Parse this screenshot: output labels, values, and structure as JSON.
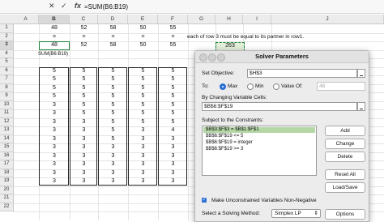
{
  "formula_bar": {
    "cancel_icon": "x-icon",
    "confirm_icon": "check-icon",
    "fx_label": "fx",
    "formula": "=SUM(B6:B19)"
  },
  "columns": [
    "A",
    "B",
    "C",
    "D",
    "E",
    "F",
    "G",
    "H",
    "I",
    "J"
  ],
  "rows": [
    "1",
    "2",
    "3",
    "4",
    "5",
    "6",
    "7",
    "8",
    "9",
    "10",
    "11",
    "12",
    "13",
    "14",
    "15",
    "16",
    "17",
    "18",
    "19",
    "20",
    "21",
    "22"
  ],
  "sheet": {
    "row1": [
      "48",
      "52",
      "58",
      "50",
      "55"
    ],
    "row2": [
      "=",
      "=",
      "=",
      "=",
      "="
    ],
    "row3": [
      "48",
      "52",
      "58",
      "50",
      "55"
    ],
    "b4_label": "SUM(B6:B19)",
    "h3_value": "263",
    "note": "each of row 3 must be equal to its partner in row1.",
    "data_rows": [
      [
        "5",
        "5",
        "5",
        "5",
        "5"
      ],
      [
        "5",
        "5",
        "5",
        "5",
        "5"
      ],
      [
        "5",
        "5",
        "5",
        "5",
        "5"
      ],
      [
        "5",
        "5",
        "5",
        "5",
        "5"
      ],
      [
        "3",
        "5",
        "5",
        "5",
        "5"
      ],
      [
        "3",
        "5",
        "5",
        "5",
        "5"
      ],
      [
        "3",
        "3",
        "5",
        "5",
        "5"
      ],
      [
        "3",
        "3",
        "5",
        "3",
        "4"
      ],
      [
        "3",
        "3",
        "5",
        "3",
        "3"
      ],
      [
        "3",
        "3",
        "3",
        "3",
        "3"
      ],
      [
        "3",
        "3",
        "3",
        "3",
        "3"
      ],
      [
        "3",
        "3",
        "3",
        "3",
        "3"
      ],
      [
        "3",
        "3",
        "3",
        "3",
        "3"
      ],
      [
        "3",
        "3",
        "3",
        "3",
        "3"
      ]
    ]
  },
  "solver": {
    "title": "Solver Parameters",
    "set_objective_label": "Set Objective:",
    "objective_value": "$H$3",
    "to_label": "To:",
    "max_label": "Max",
    "min_label": "Min",
    "valueof_label": "Value Of:",
    "valueof_value": "48",
    "changing_label": "By Changing Variable Cells:",
    "changing_value": "$B$6:$F$19",
    "constraints_label": "Subject to the Constraints:",
    "constraints": [
      "$B$3:$F$3 = $B$1:$F$1",
      "$B$6:$F$19 <= 5",
      "$B$6:$F$19 = integer",
      "$B$6:$F$19 >= 3"
    ],
    "buttons": {
      "add": "Add",
      "change": "Change",
      "delete": "Delete",
      "reset_all": "Reset All",
      "load_save": "Load/Save",
      "options": "Options"
    },
    "nonneg_label": "Make Unconstrained Variables Non-Negative",
    "method_label": "Select a Solving Method:",
    "method_value": "Simplex LP"
  }
}
